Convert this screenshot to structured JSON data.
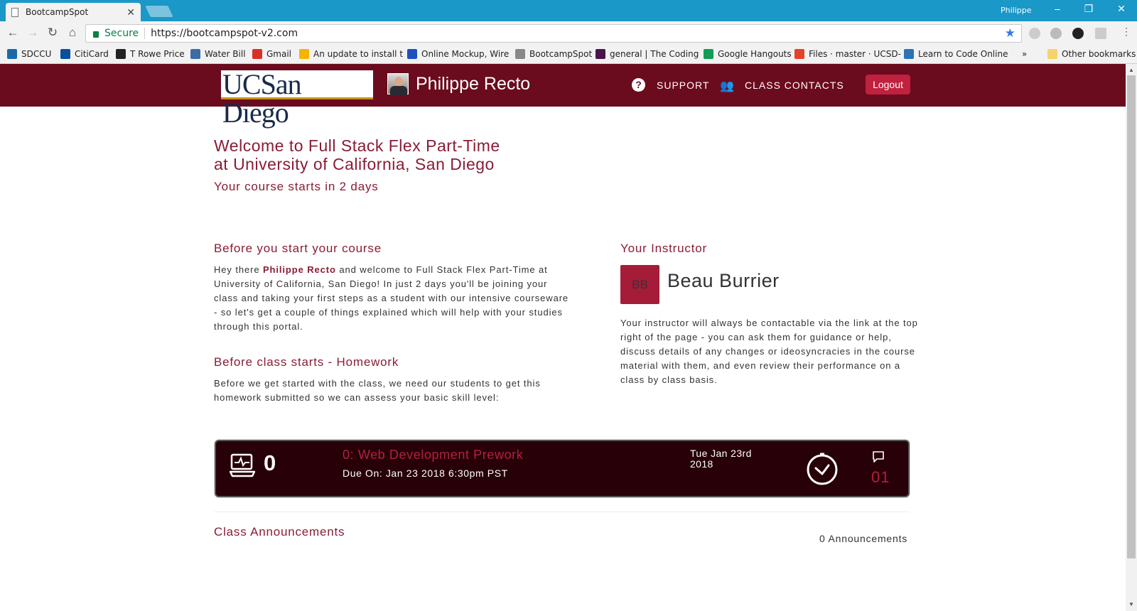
{
  "browser": {
    "tab_title": "BootcampSpot",
    "profile_name": "Philippe",
    "secure_label": "Secure",
    "url": "https://bootcampspot-v2.com",
    "bookmarks": [
      {
        "label": "SDCCU",
        "color": "#1a6aa8"
      },
      {
        "label": "CitiCard",
        "color": "#0a4f9c"
      },
      {
        "label": "T Rowe Price",
        "color": "#222222"
      },
      {
        "label": "Water Bill",
        "color": "#3a6ea5"
      },
      {
        "label": "Gmail",
        "color": "#d93025"
      },
      {
        "label": "An update to install t",
        "color": "#f4b400"
      },
      {
        "label": "Online Mockup, Wire",
        "color": "#1e4fbf"
      },
      {
        "label": "BootcampSpot",
        "color": "#888888"
      },
      {
        "label": "general | The Coding",
        "color": "#4a154b"
      },
      {
        "label": "Google Hangouts",
        "color": "#0f9d58"
      },
      {
        "label": "Files · master · UCSD-",
        "color": "#e24329"
      },
      {
        "label": "Learn to Code Online",
        "color": "#2b73b7"
      }
    ],
    "more_bookmarks": "»",
    "other_bookmarks": "Other bookmarks"
  },
  "header": {
    "logo_text": "UCSan Diego",
    "user_name": "Philippe Recto",
    "support_label": "SUPPORT",
    "contacts_label": "CLASS CONTACTS",
    "logout_label": "Logout"
  },
  "welcome": {
    "line1": "Welcome to Full Stack Flex Part-Time",
    "line2": "at University of California, San Diego",
    "starts": "Your course starts in 2 days"
  },
  "before_start": {
    "heading": "Before you start your course",
    "intro_prefix": "Hey there ",
    "name": "Philippe Recto",
    "intro_suffix": " and welcome to Full Stack Flex Part-Time at University of California, San Diego! In just 2 days you'll be joining your class and taking your first steps as a student with our intensive courseware - so let's get a couple of things explained which will help with your studies through this portal."
  },
  "homework_section": {
    "heading": "Before class starts - Homework",
    "text": "Before we get started with the class, we need our students to get this homework submitted so we can assess your basic skill level:"
  },
  "instructor": {
    "heading": "Your Instructor",
    "initials": "BB",
    "name": "Beau Burrier",
    "text": "Your instructor will always be contactable via the link at the top right of the page - you can ask them for guidance or help, discuss details of any changes or ideosyncracies in the course material with them, and even review their performance on a class by class basis."
  },
  "homework_card": {
    "number": "0",
    "title": "0: Web Development Prework",
    "due": "Due On: Jan 23 2018 6:30pm PST",
    "date_line1": "Tue Jan 23rd",
    "date_line2": "2018",
    "comment_count": "01"
  },
  "announcements": {
    "heading": "Class Announcements",
    "count": "0 Announcements"
  },
  "colors": {
    "brand_maroon": "#6b0b1e",
    "accent_red": "#c0213f",
    "heading_text": "#8a1c35",
    "card_bg": "#270008"
  }
}
